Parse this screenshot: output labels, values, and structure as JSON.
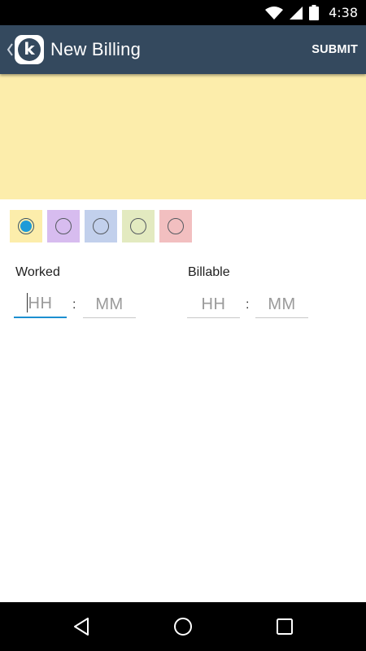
{
  "status_bar": {
    "time": "4:38",
    "icons": [
      "wifi-icon",
      "cell-signal-icon",
      "battery-icon"
    ]
  },
  "app_bar": {
    "title": "New Billing",
    "logo_letter": "k",
    "submit_label": "SUBMIT",
    "background": "#34495e"
  },
  "note_area": {
    "background": "#fcedab"
  },
  "color_options": [
    {
      "name": "yellow",
      "color": "#fcedab",
      "selected": true
    },
    {
      "name": "purple",
      "color": "#d7bcef",
      "selected": false
    },
    {
      "name": "blue",
      "color": "#c2d0ec",
      "selected": false
    },
    {
      "name": "green",
      "color": "#e3eac0",
      "selected": false
    },
    {
      "name": "red",
      "color": "#f2bfc0",
      "selected": false
    }
  ],
  "worked": {
    "label": "Worked",
    "hours_placeholder": "HH",
    "minutes_placeholder": "MM",
    "separator": ":"
  },
  "billable": {
    "label": "Billable",
    "hours_placeholder": "HH",
    "minutes_placeholder": "MM",
    "separator": ":"
  },
  "nav_bar": {
    "icons": [
      "back-nav-icon",
      "home-nav-icon",
      "recents-nav-icon"
    ]
  }
}
